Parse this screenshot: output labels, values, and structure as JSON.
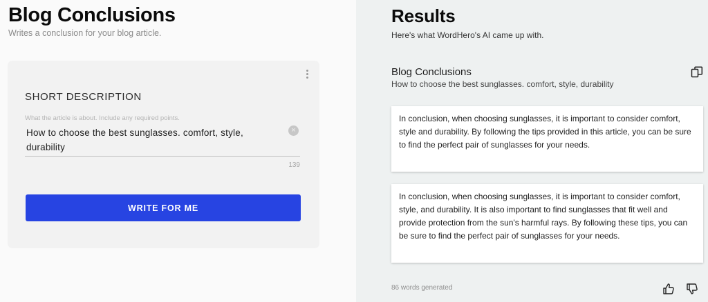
{
  "left": {
    "title": "Blog Conclusions",
    "subtitle": "Writes a conclusion for your blog article.",
    "form": {
      "field_label": "SHORT DESCRIPTION",
      "field_hint": "What the article is about. Include any required points.",
      "field_value": "How to choose the best sunglasses. comfort, style, durability",
      "char_count": "139",
      "clear_icon": "×",
      "menu_icon": "kebab-menu-icon",
      "submit_label": "WRITE FOR ME"
    }
  },
  "right": {
    "title": "Results",
    "subtitle": "Here's what WordHero's AI came up with.",
    "result_heading": "Blog Conclusions",
    "result_description": "How to choose the best sunglasses. comfort, style, durability",
    "copy_icon": "copy-icon",
    "results": [
      "In conclusion, when choosing sunglasses, it is important to consider comfort, style and durability. By following the tips provided in this article, you can be sure to find the perfect pair of sunglasses for your needs.",
      "In conclusion, when choosing sunglasses, it is important to consider comfort, style, and durability. It is also important to find sunglasses that fit well and provide protection from the sun's harmful rays. By following these tips, you can be sure to find the perfect pair of sunglasses for your needs."
    ],
    "words_generated": "86 words generated",
    "feedback_icons": [
      "thumbs-up-icon",
      "thumbs-down-icon"
    ]
  },
  "colors": {
    "accent": "#2744e2",
    "left_background": "#fafafa",
    "right_background": "#eef1f1",
    "card_background": "#f2f2f2"
  }
}
